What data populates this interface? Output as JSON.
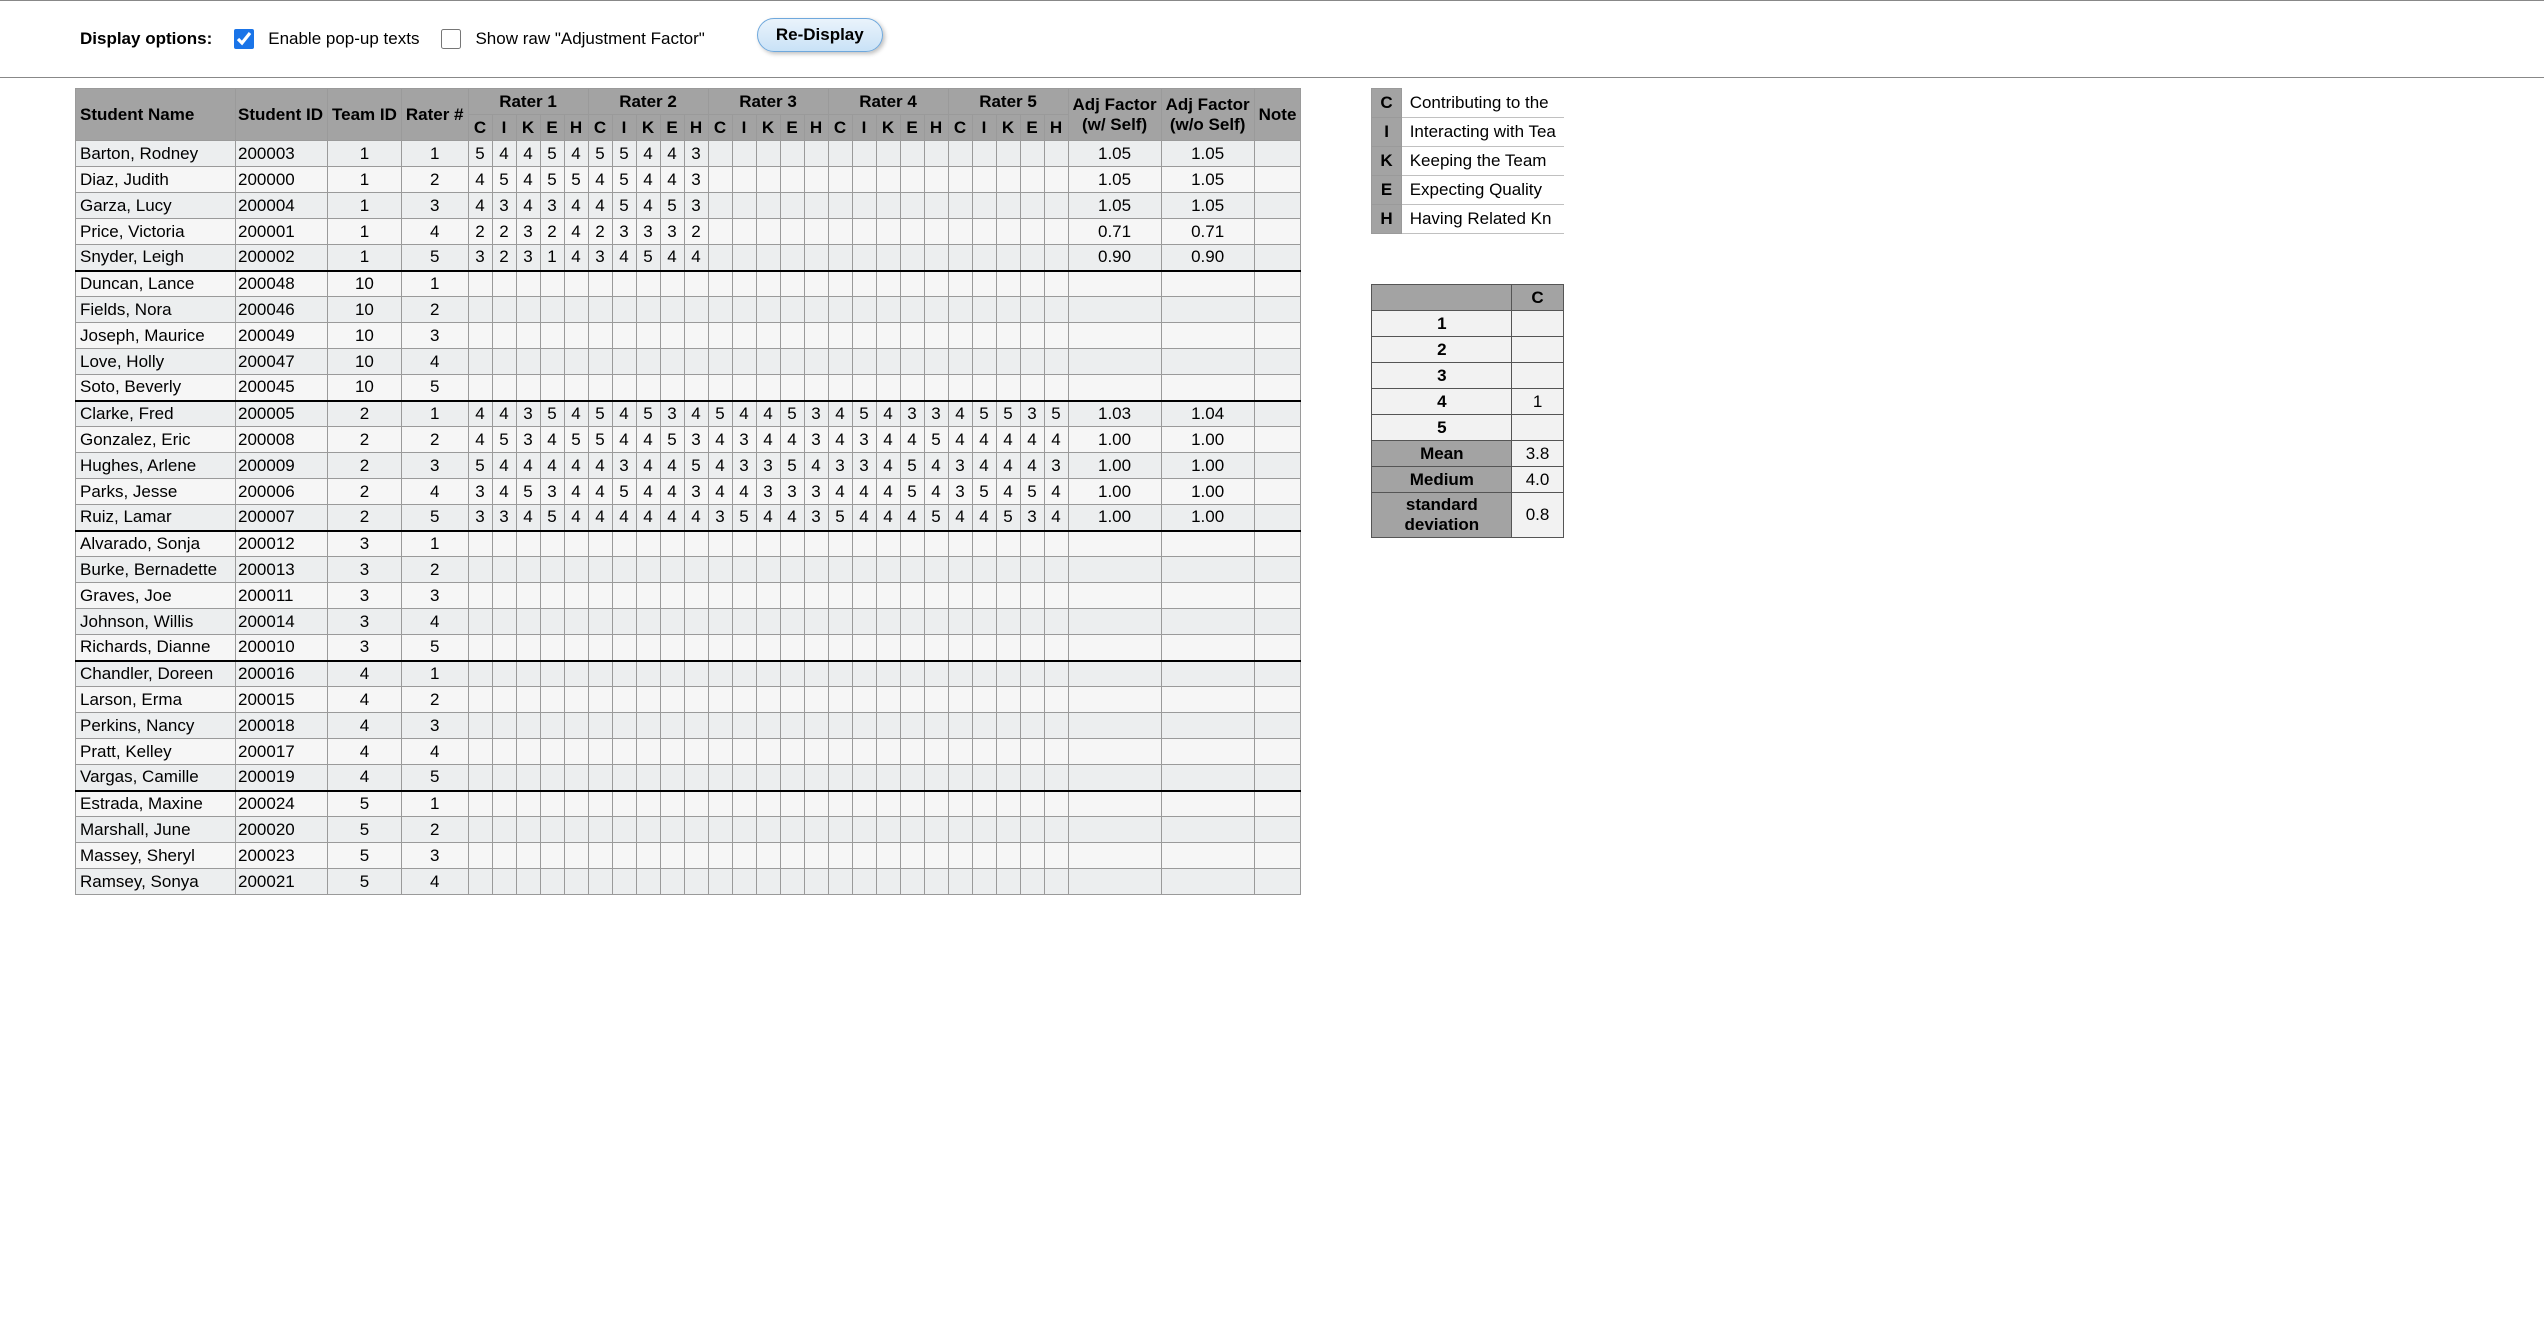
{
  "options": {
    "label": "Display options:",
    "enable_popups_label": "Enable pop-up texts",
    "enable_popups_checked": true,
    "show_raw_label": "Show raw \"Adjustment Factor\"",
    "show_raw_checked": false,
    "redisplay_label": "Re-Display"
  },
  "headers": {
    "student_name": "Student Name",
    "student_id": "Student ID",
    "team_id": "Team ID",
    "rater_num": "Rater #",
    "rater_group": [
      "Rater 1",
      "Rater 2",
      "Rater 3",
      "Rater 4",
      "Rater 5"
    ],
    "cikeh": [
      "C",
      "I",
      "K",
      "E",
      "H"
    ],
    "adj_w_self": "Adj Factor (w/ Self)",
    "adj_wo_self": "Adj Factor (w/o Self)",
    "note": "Note"
  },
  "rows": [
    {
      "name": "Barton, Rodney",
      "sid": "200003",
      "team": "1",
      "rater": "1",
      "scores": [
        [
          "5",
          "4",
          "4",
          "5",
          "4"
        ],
        [
          "5",
          "5",
          "4",
          "4",
          "3"
        ],
        [],
        [],
        []
      ],
      "adj_w": "1.05",
      "adj_wo": "1.05",
      "tsep": false
    },
    {
      "name": "Diaz, Judith",
      "sid": "200000",
      "team": "1",
      "rater": "2",
      "scores": [
        [
          "4",
          "5",
          "4",
          "5",
          "5"
        ],
        [
          "4",
          "5",
          "4",
          "4",
          "3"
        ],
        [],
        [],
        []
      ],
      "adj_w": "1.05",
      "adj_wo": "1.05",
      "tsep": false
    },
    {
      "name": "Garza, Lucy",
      "sid": "200004",
      "team": "1",
      "rater": "3",
      "scores": [
        [
          "4",
          "3",
          "4",
          "3",
          "4"
        ],
        [
          "4",
          "5",
          "4",
          "5",
          "3"
        ],
        [],
        [],
        []
      ],
      "adj_w": "1.05",
      "adj_wo": "1.05",
      "tsep": false
    },
    {
      "name": "Price, Victoria",
      "sid": "200001",
      "team": "1",
      "rater": "4",
      "scores": [
        [
          "2",
          "2",
          "3",
          "2",
          "4"
        ],
        [
          "2",
          "3",
          "3",
          "3",
          "2"
        ],
        [],
        [],
        []
      ],
      "adj_w": "0.71",
      "adj_wo": "0.71",
      "tsep": false
    },
    {
      "name": "Snyder, Leigh",
      "sid": "200002",
      "team": "1",
      "rater": "5",
      "scores": [
        [
          "3",
          "2",
          "3",
          "1",
          "4"
        ],
        [
          "3",
          "4",
          "5",
          "4",
          "4"
        ],
        [],
        [],
        []
      ],
      "adj_w": "0.90",
      "adj_wo": "0.90",
      "tsep": false
    },
    {
      "name": "Duncan, Lance",
      "sid": "200048",
      "team": "10",
      "rater": "1",
      "scores": [
        [],
        [],
        [],
        [],
        []
      ],
      "adj_w": "",
      "adj_wo": "",
      "tsep": true
    },
    {
      "name": "Fields, Nora",
      "sid": "200046",
      "team": "10",
      "rater": "2",
      "scores": [
        [],
        [],
        [],
        [],
        []
      ],
      "adj_w": "",
      "adj_wo": "",
      "tsep": false
    },
    {
      "name": "Joseph, Maurice",
      "sid": "200049",
      "team": "10",
      "rater": "3",
      "scores": [
        [],
        [],
        [],
        [],
        []
      ],
      "adj_w": "",
      "adj_wo": "",
      "tsep": false
    },
    {
      "name": "Love, Holly",
      "sid": "200047",
      "team": "10",
      "rater": "4",
      "scores": [
        [],
        [],
        [],
        [],
        []
      ],
      "adj_w": "",
      "adj_wo": "",
      "tsep": false
    },
    {
      "name": "Soto, Beverly",
      "sid": "200045",
      "team": "10",
      "rater": "5",
      "scores": [
        [],
        [],
        [],
        [],
        []
      ],
      "adj_w": "",
      "adj_wo": "",
      "tsep": false
    },
    {
      "name": "Clarke, Fred",
      "sid": "200005",
      "team": "2",
      "rater": "1",
      "scores": [
        [
          "4",
          "4",
          "3",
          "5",
          "4"
        ],
        [
          "5",
          "4",
          "5",
          "3",
          "4"
        ],
        [
          "5",
          "4",
          "4",
          "5",
          "3"
        ],
        [
          "4",
          "5",
          "4",
          "3",
          "3"
        ],
        [
          "4",
          "5",
          "5",
          "3",
          "5"
        ]
      ],
      "adj_w": "1.03",
      "adj_wo": "1.04",
      "tsep": true
    },
    {
      "name": "Gonzalez, Eric",
      "sid": "200008",
      "team": "2",
      "rater": "2",
      "scores": [
        [
          "4",
          "5",
          "3",
          "4",
          "5"
        ],
        [
          "5",
          "4",
          "4",
          "5",
          "3"
        ],
        [
          "4",
          "3",
          "4",
          "4",
          "3"
        ],
        [
          "4",
          "3",
          "4",
          "4",
          "5"
        ],
        [
          "4",
          "4",
          "4",
          "4",
          "4"
        ]
      ],
      "adj_w": "1.00",
      "adj_wo": "1.00",
      "tsep": false
    },
    {
      "name": "Hughes, Arlene",
      "sid": "200009",
      "team": "2",
      "rater": "3",
      "scores": [
        [
          "5",
          "4",
          "4",
          "4",
          "4"
        ],
        [
          "4",
          "3",
          "4",
          "4",
          "5"
        ],
        [
          "4",
          "3",
          "3",
          "5",
          "4"
        ],
        [
          "3",
          "3",
          "4",
          "5",
          "4"
        ],
        [
          "3",
          "4",
          "4",
          "4",
          "3"
        ]
      ],
      "adj_w": "1.00",
      "adj_wo": "1.00",
      "tsep": false
    },
    {
      "name": "Parks, Jesse",
      "sid": "200006",
      "team": "2",
      "rater": "4",
      "scores": [
        [
          "3",
          "4",
          "5",
          "3",
          "4"
        ],
        [
          "4",
          "5",
          "4",
          "4",
          "3"
        ],
        [
          "4",
          "4",
          "3",
          "3",
          "3"
        ],
        [
          "4",
          "4",
          "4",
          "5",
          "4"
        ],
        [
          "3",
          "5",
          "4",
          "5",
          "4"
        ]
      ],
      "adj_w": "1.00",
      "adj_wo": "1.00",
      "tsep": false
    },
    {
      "name": "Ruiz, Lamar",
      "sid": "200007",
      "team": "2",
      "rater": "5",
      "scores": [
        [
          "3",
          "3",
          "4",
          "5",
          "4"
        ],
        [
          "4",
          "4",
          "4",
          "4",
          "4"
        ],
        [
          "3",
          "5",
          "4",
          "4",
          "3"
        ],
        [
          "5",
          "4",
          "4",
          "4",
          "5"
        ],
        [
          "4",
          "4",
          "5",
          "3",
          "4"
        ]
      ],
      "adj_w": "1.00",
      "adj_wo": "1.00",
      "tsep": false
    },
    {
      "name": "Alvarado, Sonja",
      "sid": "200012",
      "team": "3",
      "rater": "1",
      "scores": [
        [],
        [],
        [],
        [],
        []
      ],
      "adj_w": "",
      "adj_wo": "",
      "tsep": true
    },
    {
      "name": "Burke, Bernadette",
      "sid": "200013",
      "team": "3",
      "rater": "2",
      "scores": [
        [],
        [],
        [],
        [],
        []
      ],
      "adj_w": "",
      "adj_wo": "",
      "tsep": false
    },
    {
      "name": "Graves, Joe",
      "sid": "200011",
      "team": "3",
      "rater": "3",
      "scores": [
        [],
        [],
        [],
        [],
        []
      ],
      "adj_w": "",
      "adj_wo": "",
      "tsep": false
    },
    {
      "name": "Johnson, Willis",
      "sid": "200014",
      "team": "3",
      "rater": "4",
      "scores": [
        [],
        [],
        [],
        [],
        []
      ],
      "adj_w": "",
      "adj_wo": "",
      "tsep": false
    },
    {
      "name": "Richards, Dianne",
      "sid": "200010",
      "team": "3",
      "rater": "5",
      "scores": [
        [],
        [],
        [],
        [],
        []
      ],
      "adj_w": "",
      "adj_wo": "",
      "tsep": false
    },
    {
      "name": "Chandler, Doreen",
      "sid": "200016",
      "team": "4",
      "rater": "1",
      "scores": [
        [],
        [],
        [],
        [],
        []
      ],
      "adj_w": "",
      "adj_wo": "",
      "tsep": true
    },
    {
      "name": "Larson, Erma",
      "sid": "200015",
      "team": "4",
      "rater": "2",
      "scores": [
        [],
        [],
        [],
        [],
        []
      ],
      "adj_w": "",
      "adj_wo": "",
      "tsep": false
    },
    {
      "name": "Perkins, Nancy",
      "sid": "200018",
      "team": "4",
      "rater": "3",
      "scores": [
        [],
        [],
        [],
        [],
        []
      ],
      "adj_w": "",
      "adj_wo": "",
      "tsep": false
    },
    {
      "name": "Pratt, Kelley",
      "sid": "200017",
      "team": "4",
      "rater": "4",
      "scores": [
        [],
        [],
        [],
        [],
        []
      ],
      "adj_w": "",
      "adj_wo": "",
      "tsep": false
    },
    {
      "name": "Vargas, Camille",
      "sid": "200019",
      "team": "4",
      "rater": "5",
      "scores": [
        [],
        [],
        [],
        [],
        []
      ],
      "adj_w": "",
      "adj_wo": "",
      "tsep": false
    },
    {
      "name": "Estrada, Maxine",
      "sid": "200024",
      "team": "5",
      "rater": "1",
      "scores": [
        [],
        [],
        [],
        [],
        []
      ],
      "adj_w": "",
      "adj_wo": "",
      "tsep": true
    },
    {
      "name": "Marshall, June",
      "sid": "200020",
      "team": "5",
      "rater": "2",
      "scores": [
        [],
        [],
        [],
        [],
        []
      ],
      "adj_w": "",
      "adj_wo": "",
      "tsep": false
    },
    {
      "name": "Massey, Sheryl",
      "sid": "200023",
      "team": "5",
      "rater": "3",
      "scores": [
        [],
        [],
        [],
        [],
        []
      ],
      "adj_w": "",
      "adj_wo": "",
      "tsep": false
    },
    {
      "name": "Ramsey, Sonya",
      "sid": "200021",
      "team": "5",
      "rater": "4",
      "scores": [
        [],
        [],
        [],
        [],
        []
      ],
      "adj_w": "",
      "adj_wo": "",
      "tsep": false
    }
  ],
  "legend": [
    {
      "letter": "C",
      "text": "Contributing to the"
    },
    {
      "letter": "I",
      "text": "Interacting with Tea"
    },
    {
      "letter": "K",
      "text": "Keeping the Team"
    },
    {
      "letter": "E",
      "text": "Expecting Quality"
    },
    {
      "letter": "H",
      "text": "Having Related Kn"
    }
  ],
  "stats": {
    "col_header_partial": "C",
    "rows": [
      {
        "label": "1",
        "val": ""
      },
      {
        "label": "2",
        "val": ""
      },
      {
        "label": "3",
        "val": ""
      },
      {
        "label": "4",
        "val": "1"
      },
      {
        "label": "5",
        "val": ""
      }
    ],
    "summary": [
      {
        "label": "Mean",
        "val": "3.8"
      },
      {
        "label": "Medium",
        "val": "4.0"
      },
      {
        "label": "standard deviation",
        "val": "0.8"
      }
    ]
  }
}
